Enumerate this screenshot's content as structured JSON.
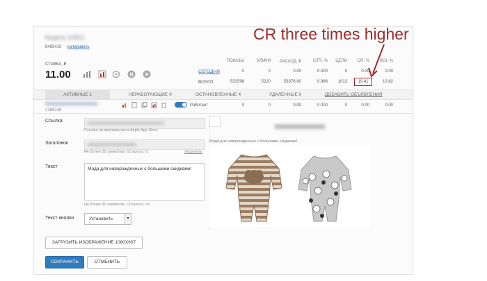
{
  "header": {
    "title_blurred": "Кедета 10801",
    "id_blurred": "6495410",
    "copy_link": "копировать"
  },
  "bid": {
    "label": "СТАВКА, ₽",
    "value": "11.00"
  },
  "stats": {
    "columns": [
      "ПОКАЗЫ",
      "КЛИКИ",
      "РАСХОД, ₽",
      "CTR, %",
      "ЦЕЛИ",
      "CR, %",
      "ROI, %"
    ],
    "rows": [
      {
        "label": "СЕГОДНЯ",
        "values": [
          "0",
          "0",
          "0.00",
          "0.000",
          "0",
          "0.00",
          "0.00"
        ]
      },
      {
        "label": "ВСЕГО",
        "values": [
          "532598",
          "5220",
          "53376.60",
          "0.986",
          "1013",
          "19.41",
          "10.82"
        ]
      }
    ]
  },
  "tabs": [
    {
      "label": "АКТИВНЫЕ 1"
    },
    {
      "label": "НЕРАБОТАЮЩИЕ 0"
    },
    {
      "label": "ОСТАНОВЛЕННЫЕ 4"
    },
    {
      "label": "УДАЛЕННЫЕ 0"
    },
    {
      "label": "ДОБАВИТЬ ОБЪЯВЛЕНИЯ"
    }
  ],
  "ad_row": {
    "id": "2166148",
    "status_text": "Работает",
    "values": [
      "0",
      "0",
      "0.00",
      "0.000",
      "0",
      "0.00",
      "0.00"
    ]
  },
  "form": {
    "link_label": "Ссылка",
    "link_hint": "Ссылка на приложение в Apple App Store",
    "title_label": "Заголовок",
    "title_hint": "Не более 25 символов. Осталось: 0.",
    "title_link": "Укоротить",
    "text_label": "Текст",
    "text_value": "Мода для новорожденных с большими скидками!",
    "text_hint": "Не более 90 символов. Осталось: 47",
    "button_text_label": "Текст кнопки",
    "button_text_value": "Установить",
    "upload_button": "ЗАГРУЗИТЬ ИЗОБРАЖЕНИЕ 1080X607",
    "save_button": "СОХРАНИТЬ",
    "cancel_button": "ОТМЕНИТЬ"
  },
  "preview": {
    "caption": "Мода для новорожденных с большими скидками!"
  },
  "annotation": {
    "text": "CR three times higher",
    "color": "#9e2b2b"
  },
  "colors": {
    "accent": "#2f7bbd",
    "annotation": "#9e2b2b"
  }
}
